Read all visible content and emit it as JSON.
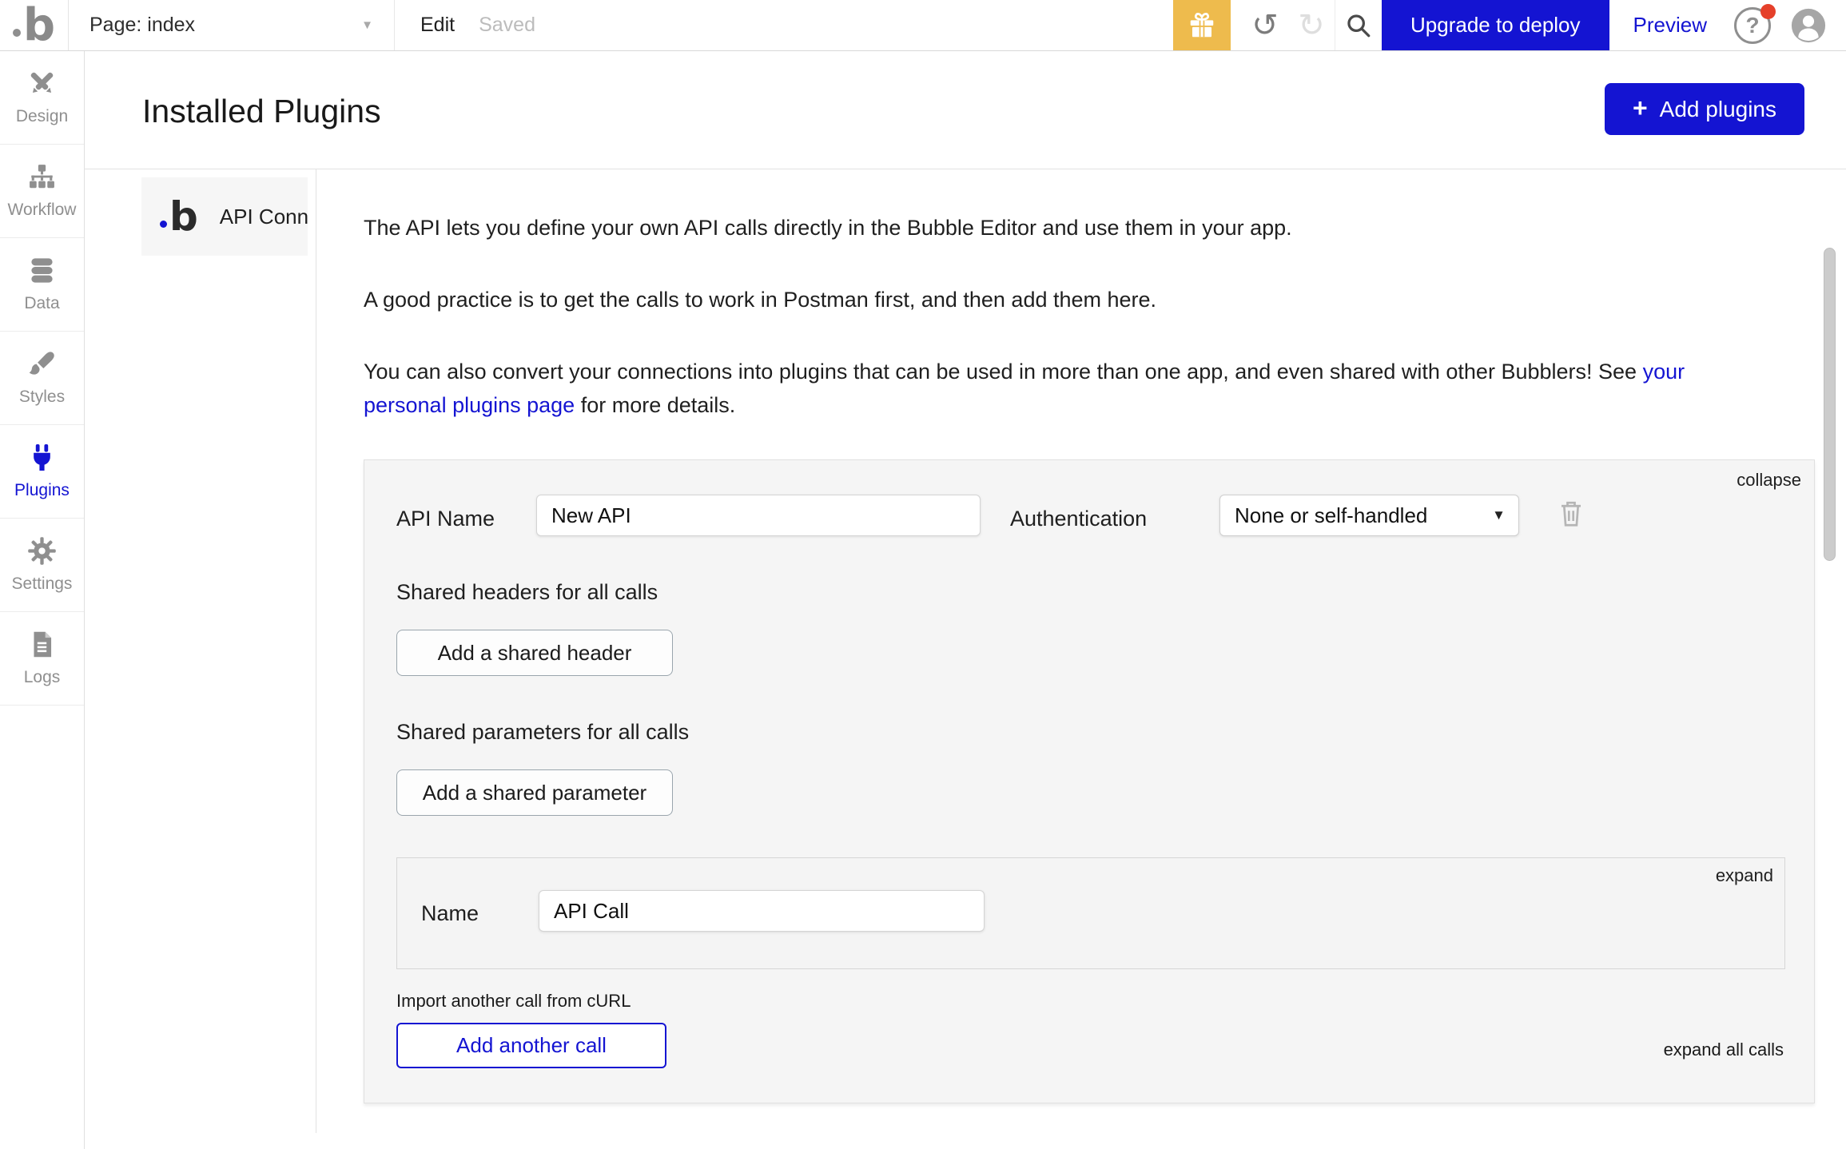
{
  "colors": {
    "accent_blue": "#1414d2",
    "gift_orange": "#eebb4d",
    "alert_red": "#e5402a"
  },
  "icons": {
    "plus": "+",
    "caret_down": "▼",
    "undo": "↺",
    "redo": "↻",
    "help": "?",
    "logo_char": "b"
  },
  "topbar": {
    "page_selector": "Page: index",
    "edit": "Edit",
    "saved": "Saved",
    "upgrade_button": "Upgrade to deploy",
    "preview": "Preview"
  },
  "sidebar": {
    "active_item": "Plugins",
    "items": [
      {
        "label": "Design"
      },
      {
        "label": "Workflow"
      },
      {
        "label": "Data"
      },
      {
        "label": "Styles"
      },
      {
        "label": "Plugins"
      },
      {
        "label": "Settings"
      },
      {
        "label": "Logs"
      }
    ]
  },
  "plugins_page": {
    "title": "Installed Plugins",
    "add_plugins_button": "Add plugins",
    "plugin_list": [
      {
        "name": "API Connector"
      }
    ],
    "description": {
      "p1": "The API lets you define your own API calls directly in the Bubble Editor and use them in your app.",
      "p2": "A good practice is to get the calls to work in Postman first, and then add them here.",
      "p3_before": "You can also convert your connections into plugins that can be used in more than one app, and even shared with other Bubblers! See ",
      "p3_link": "your personal plugins page",
      "p3_after": " for more details."
    },
    "api_panel": {
      "collapse": "collapse",
      "api_name_label": "API Name",
      "api_name_value": "New API",
      "auth_label": "Authentication",
      "auth_value": "None or self-handled",
      "shared_headers_label": "Shared headers for all calls",
      "add_shared_header_button": "Add a shared header",
      "shared_params_label": "Shared parameters for all calls",
      "add_shared_param_button": "Add a shared parameter",
      "call": {
        "expand": "expand",
        "name_label": "Name",
        "name_value": "API Call"
      },
      "import_curl": "Import another call from cURL",
      "add_another_call_button": "Add another call",
      "expand_all": "expand all calls"
    }
  }
}
